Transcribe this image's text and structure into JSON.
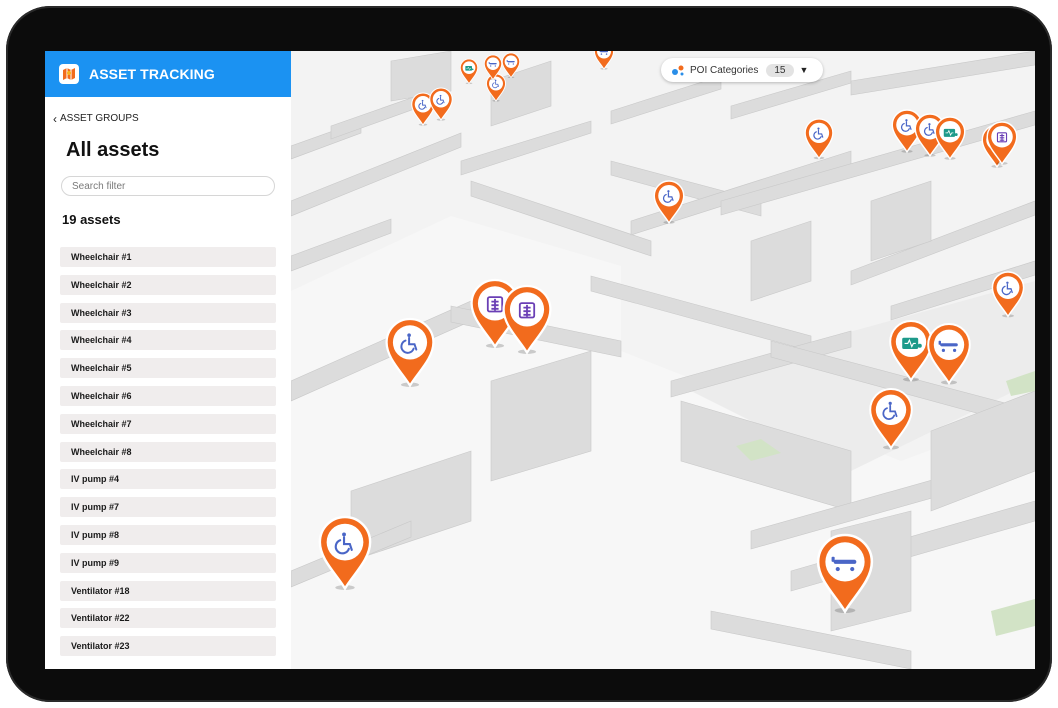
{
  "header": {
    "title": "ASSET TRACKING",
    "logo_icon": "map-logo-icon"
  },
  "sidebar": {
    "back_label": "ASSET GROUPS",
    "heading": "All assets",
    "search_placeholder": "Search filter",
    "count_label": "19 assets",
    "assets": [
      "Wheelchair #1",
      "Wheelchair #2",
      "Wheelchair #3",
      "Wheelchair #4",
      "Wheelchair #5",
      "Wheelchair #6",
      "Wheelchair #7",
      "Wheelchair #8",
      "IV pump #4",
      "IV pump #7",
      "IV pump #8",
      "IV pump #9",
      "Ventilator #18",
      "Ventilator #22",
      "Ventilator #23"
    ]
  },
  "map": {
    "poi_label": "POI Categories",
    "poi_count": "15",
    "pin_colors": {
      "orange": "#f26b1d",
      "wheelchair": "#4a66c7",
      "bed": "#4a66c7",
      "pump": "#6a3fb5",
      "ventilator": "#1d9a8a"
    },
    "pins": [
      {
        "type": "wheelchair"
      },
      {
        "type": "wheelchair"
      },
      {
        "type": "wheelchair"
      },
      {
        "type": "ventilator"
      },
      {
        "type": "bed"
      },
      {
        "type": "bed"
      },
      {
        "type": "bed"
      },
      {
        "type": "wheelchair"
      },
      {
        "type": "wheelchair"
      },
      {
        "type": "wheelchair"
      },
      {
        "type": "wheelchair"
      },
      {
        "type": "ventilator"
      },
      {
        "type": "bed"
      },
      {
        "type": "pump"
      },
      {
        "type": "wheelchair"
      },
      {
        "type": "wheelchair"
      },
      {
        "type": "pump"
      },
      {
        "type": "pump"
      },
      {
        "type": "ventilator"
      },
      {
        "type": "bed"
      },
      {
        "type": "wheelchair"
      },
      {
        "type": "wheelchair"
      },
      {
        "type": "bed"
      }
    ]
  }
}
